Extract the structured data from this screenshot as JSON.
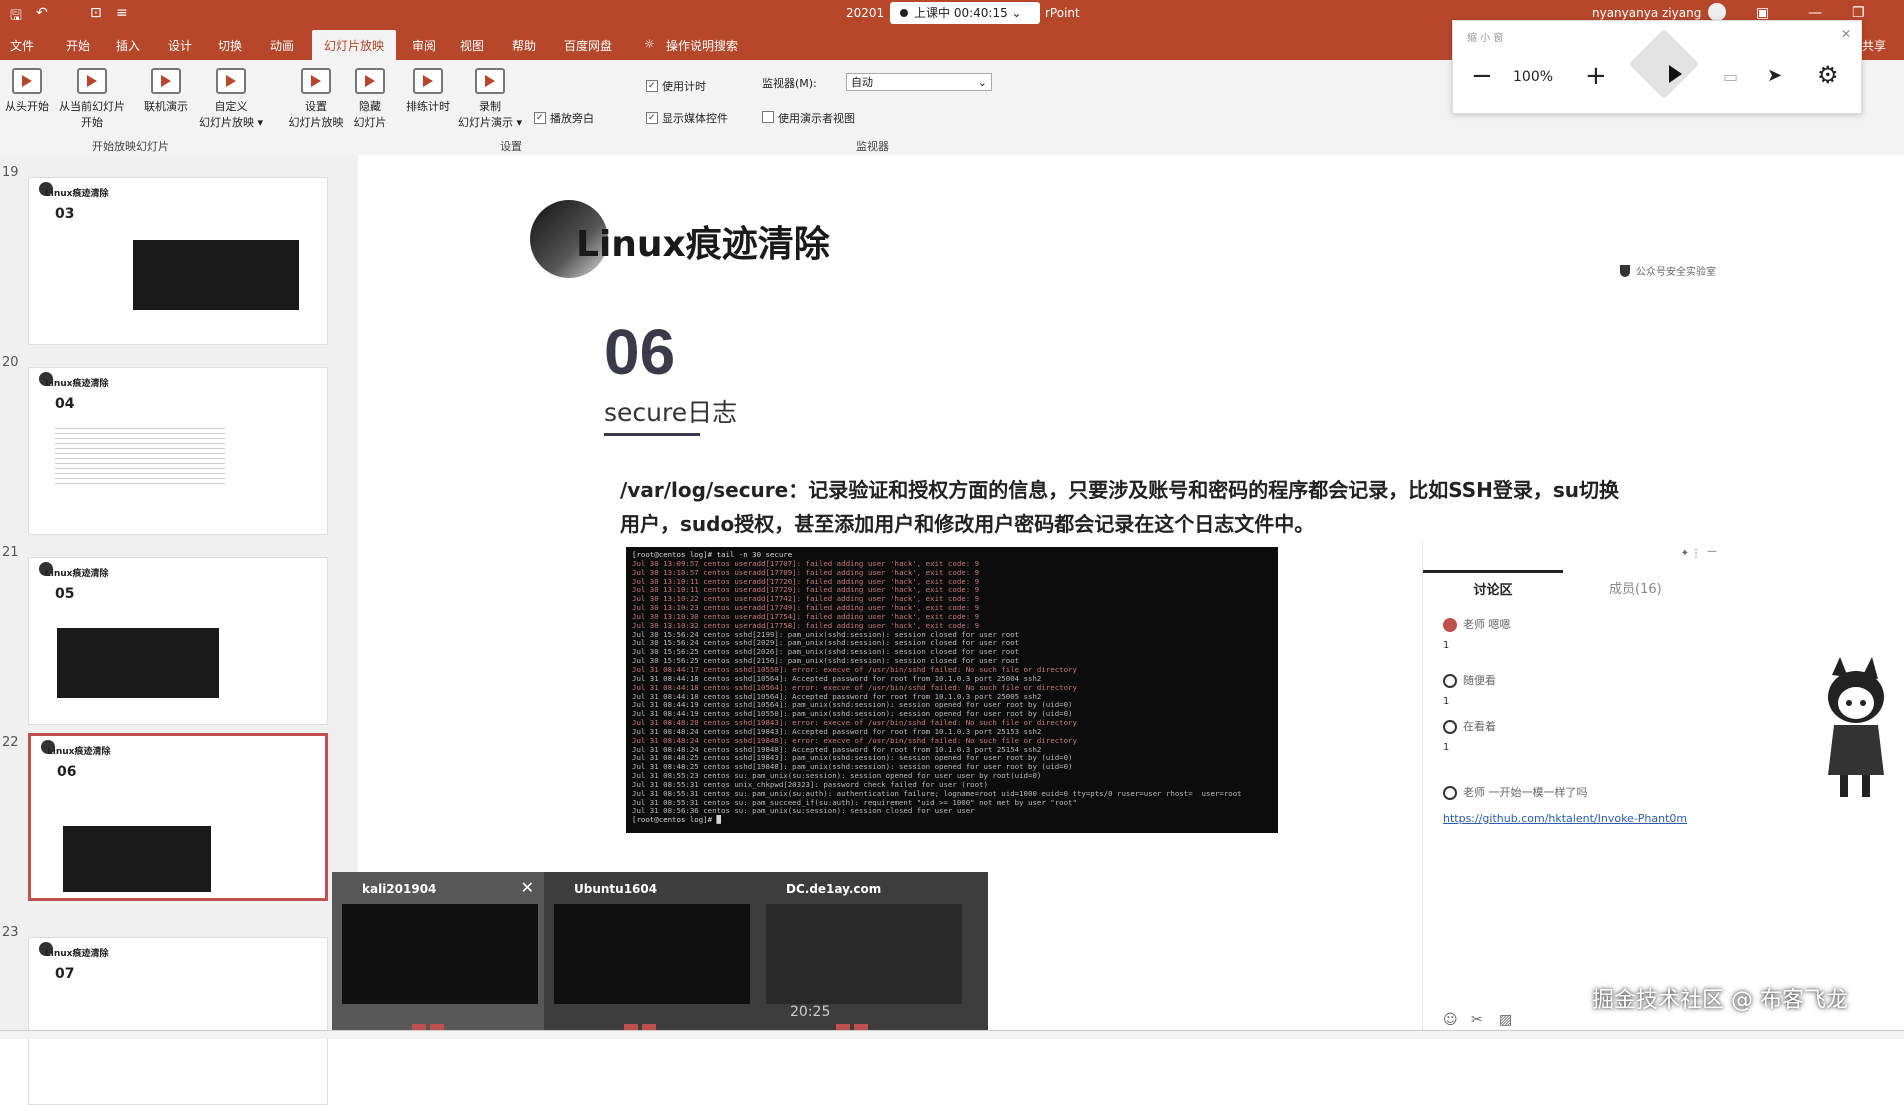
{
  "titlebar": {
    "doc_prefix": "20201",
    "app_suffix": "rPoint",
    "recording_status": "上课中 00:40:15",
    "user": "nyanyanya ziyang"
  },
  "menu": [
    "文件",
    "开始",
    "插入",
    "设计",
    "切换",
    "动画",
    "幻灯片放映",
    "审阅",
    "视图",
    "帮助",
    "百度网盘",
    "操作说明搜索",
    "共享"
  ],
  "ribbon": {
    "buttons": [
      {
        "label1": "从头开始",
        "label2": ""
      },
      {
        "label1": "从当前幻灯片",
        "label2": "开始"
      },
      {
        "label1": "联机演示",
        "label2": ""
      },
      {
        "label1": "自定义",
        "label2": "幻灯片放映 ▾"
      },
      {
        "label1": "设置",
        "label2": "幻灯片放映"
      },
      {
        "label1": "隐藏",
        "label2": "幻灯片"
      },
      {
        "label1": "排练计时",
        "label2": ""
      },
      {
        "label1": "录制",
        "label2": "幻灯片演示 ▾"
      }
    ],
    "checkboxes": [
      {
        "label": "使用计时",
        "checked": true
      },
      {
        "label": "播放旁白",
        "checked": true
      },
      {
        "label": "显示媒体控件",
        "checked": true
      },
      {
        "label": "使用演示者视图",
        "checked": false
      }
    ],
    "monitor_label": "监视器(M):",
    "monitor_value": "自动",
    "groups": [
      "开始放映幻灯片",
      "设置",
      "监视器"
    ]
  },
  "thumbnails": [
    {
      "slide_no": "19",
      "num": "03",
      "title": "Linux痕迹清除"
    },
    {
      "slide_no": "20",
      "num": "04",
      "title": "Linux痕迹清除"
    },
    {
      "slide_no": "21",
      "num": "05",
      "title": "Linux痕迹清除"
    },
    {
      "slide_no": "22",
      "num": "06",
      "title": "Linux痕迹清除",
      "selected": true
    },
    {
      "slide_no": "23",
      "num": "07",
      "title": "Linux痕迹清除"
    }
  ],
  "slide": {
    "title": "Linux痕迹清除",
    "logo_text": "公众号安全实验室",
    "number": "06",
    "subtitle": "secure日志",
    "desc_line1": "/var/log/secure：记录验证和授权方面的信息，只要涉及账号和密码的程序都会记录，比如SSH登录，su切换",
    "desc_line2": "用户，sudo授权，甚至添加用户和修改用户密码都会记录在这个日志文件中。",
    "terminal_lines": [
      "[root@centos log]# tail -n 30 secure",
      "Jul 30 13:09:57 centos useradd[17707]: failed adding user 'hack', exit code: 9",
      "Jul 30 13:10:57 centos useradd[17709]: failed adding user 'hack', exit code: 9",
      "Jul 30 13:10:11 centos useradd[17720]: failed adding user 'hack', exit code: 9",
      "Jul 30 13:10:11 centos useradd[17729]: failed adding user 'hack', exit code: 9",
      "Jul 30 13:10:22 centos useradd[17742]: failed adding user 'hack', exit code: 9",
      "Jul 30 13:10:23 centos useradd[17749]: failed adding user 'hack', exit code: 9",
      "Jul 30 13:10:30 centos useradd[17754]: failed adding user 'hack', exit code: 9",
      "Jul 30 13:10:32 centos useradd[17758]: failed adding user 'hack', exit code: 9",
      "Jul 30 15:56:24 centos sshd[2199]: pam_unix(sshd:session): session closed for user root",
      "Jul 30 15:56:24 centos sshd[2029]: pam_unix(sshd:session): session closed for user root",
      "Jul 30 15:56:25 centos sshd[2026]: pam_unix(sshd:session): session closed for user root",
      "Jul 30 15:56:25 centos sshd[2150]: pam_unix(sshd:session): session closed for user root",
      "Jul 31 08:44:17 centos sshd[10550]: error: execve of /usr/bin/sshd failed: No such file or directory",
      "Jul 31 08:44:18 centos sshd[10564]: Accepted password for root from 10.1.0.3 port 25004 ssh2",
      "Jul 31 08:44:18 centos sshd[10564]: error: execve of /usr/bin/sshd failed: No such file or directory",
      "Jul 31 08:44:18 centos sshd[10564]: Accepted password for root from 10.1.0.3 port 25005 ssh2",
      "Jul 31 08:44:19 centos sshd[10564]: pam_unix(sshd:session): session opened for user root by (uid=0)",
      "Jul 31 08:44:19 centos sshd[10550]: pam_unix(sshd:session): session opened for user root by (uid=0)",
      "Jul 31 08:48:20 centos sshd[19843]: error: execve of /usr/bin/sshd failed: No such file or directory",
      "Jul 31 08:48:24 centos sshd[19843]: Accepted password for root from 10.1.0.3 port 25153 ssh2",
      "Jul 31 08:48:24 centos sshd[19848]: error: execve of /usr/bin/sshd failed: No such file or directory",
      "Jul 31 08:48:24 centos sshd[19848]: Accepted password for root from 10.1.0.3 port 25154 ssh2",
      "Jul 31 08:48:25 centos sshd[19843]: pam_unix(sshd:session): session opened for user root by (uid=0)",
      "Jul 31 08:48:25 centos sshd[19848]: pam_unix(sshd:session): session opened for user root by (uid=0)",
      "Jul 31 08:55:23 centos su: pam_unix(su:session): session opened for user user by root(uid=0)",
      "Jul 31 08:55:31 centos unix_chkpwd[20323]: password check failed for user (root)",
      "Jul 31 08:55:31 centos su: pam_unix(su:auth): authentication failure; logname=root uid=1000 euid=0 tty=pts/0 ruser=user rhost=  user=root",
      "Jul 31 08:55:31 centos su: pam_succeed_if(su:auth): requirement \"uid >= 1000\" not met by user \"root\"",
      "Jul 31 08:56:36 centos su: pam_unix(su:session): session closed for user user",
      "[root@centos log]# █"
    ]
  },
  "discussion": {
    "tabs": [
      "讨论区",
      "成员(16)"
    ],
    "posts": [
      {
        "name": "老师 嗯嗯",
        "count": "1"
      },
      {
        "name": "随便看",
        "count": "1"
      },
      {
        "name": "在看着",
        "count": "1"
      },
      {
        "name": "老师 一开始一模一样了吗",
        "count": ""
      }
    ],
    "link": "https://github.com/hktalent/Invoke-Phant0m"
  },
  "zoom": {
    "header": "缩 小 窗",
    "level": "100%"
  },
  "taskbar": {
    "windows": [
      {
        "title": "kali201904",
        "active": true
      },
      {
        "title": "Ubuntu1604",
        "active": false
      },
      {
        "title": "DC.de1ay.com",
        "active": false,
        "clock": "20:25"
      }
    ]
  },
  "watermark": "掘金技术社区 @ 布客飞龙"
}
